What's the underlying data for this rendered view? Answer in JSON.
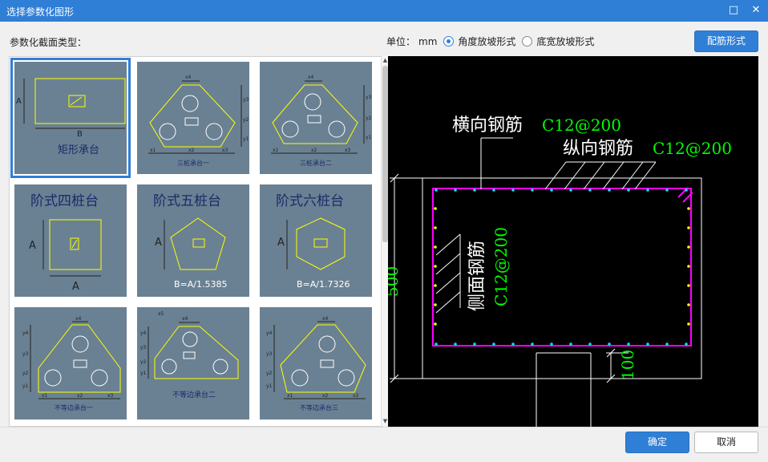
{
  "window": {
    "title": "选择参数化图形",
    "maximize_glyph": "□",
    "close_glyph": "✕"
  },
  "section_label": "参数化截面类型：",
  "unit": {
    "label": "单位：",
    "value": "mm",
    "options": [
      {
        "label": "角度放坡形式",
        "selected": true
      },
      {
        "label": "底宽放坡形式",
        "selected": false
      }
    ]
  },
  "buttons": {
    "rebar_form": "配筋形式",
    "ok": "确定",
    "cancel": "取消"
  },
  "gallery": {
    "items": [
      {
        "caption": "矩形承台",
        "selected": true,
        "dims": [
          "A",
          "B"
        ]
      },
      {
        "caption": "三桩承台一",
        "dims": [
          "x4",
          "y3",
          "y2",
          "y1",
          "x1",
          "x2",
          "x3"
        ]
      },
      {
        "caption": "三桩承台二",
        "dims": [
          "x4",
          "y3",
          "y2",
          "y1",
          "x1",
          "x2",
          "x3"
        ]
      },
      {
        "caption": "阶式四桩台",
        "dims": [
          "A",
          "A"
        ]
      },
      {
        "caption": "阶式五桩台",
        "dims": [
          "A"
        ],
        "formula": "B=A/1.5385"
      },
      {
        "caption": "阶式六桩台",
        "dims": [
          "A"
        ],
        "formula": "B=A/1.7326"
      },
      {
        "caption": "不等边承台一",
        "dims": [
          "x4",
          "y4",
          "y3",
          "y2",
          "y1",
          "x1",
          "x2",
          "x3"
        ]
      },
      {
        "caption": "不等边承台二",
        "dims": [
          "x4",
          "x5",
          "y4",
          "y3",
          "y2",
          "y1"
        ]
      },
      {
        "caption": "不等边承台三",
        "dims": [
          "x4",
          "y4",
          "y3",
          "y2",
          "y1",
          "x1",
          "x2",
          "x3"
        ]
      }
    ]
  },
  "preview": {
    "transverse_label": "横向钢筋",
    "transverse_spec": "C12@200",
    "longitudinal_label": "纵向钢筋",
    "longitudinal_spec": "C12@200",
    "side_label": "侧面钢筋",
    "side_spec": "C12@200",
    "height_dim": "500",
    "bottom_dim": "100",
    "colors": {
      "background": "#000000",
      "rebar": "#ff00ff",
      "dots": "#00e5ff",
      "side_dots": "#ffff00",
      "spec": "#00ff00",
      "text": "#ffffff"
    }
  },
  "colors": {
    "titlebar": "#2f7fd6",
    "thumb_bg": "#6a8193",
    "shape": "#ffff00"
  }
}
